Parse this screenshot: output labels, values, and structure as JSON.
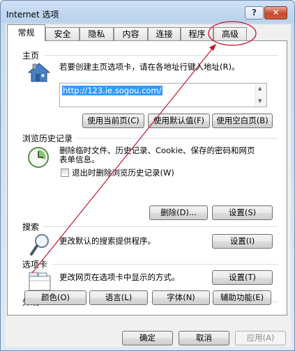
{
  "window": {
    "title": "Internet 选项",
    "help_label": "?",
    "close_label": "✕"
  },
  "tabs": [
    "常规",
    "安全",
    "隐私",
    "内容",
    "连接",
    "程序",
    "高级"
  ],
  "homepage": {
    "heading": "主页",
    "description": "若要创建主页选项卡，请在各地址行键入地址(R)。",
    "url": "http://123.ie.sogou.com/",
    "btn_current": "使用当前页(C)",
    "btn_default": "使用默认值(F)",
    "btn_blank": "使用空白页(B)"
  },
  "history": {
    "heading": "浏览历史记录",
    "description_line1": "删除临时文件、历史记录、Cookie、保存的密码和网页",
    "description_line2": "表单信息。",
    "checkbox_label": "退出时删除浏览历史记录(W)",
    "btn_delete": "删除(D)...",
    "btn_settings": "设置(S)"
  },
  "search": {
    "heading": "搜索",
    "description": "更改默认的搜索提供程序。",
    "btn_settings": "设置(I)"
  },
  "tabs_section": {
    "heading": "选项卡",
    "description": "更改网页在选项卡中显示的方式。",
    "btn_settings": "设置(T)"
  },
  "appearance": {
    "heading": "外观",
    "btn_colors": "颜色(O)",
    "btn_languages": "语言(L)",
    "btn_fonts": "字体(N)",
    "btn_accessibility": "辅助功能(E)"
  },
  "footer": {
    "ok": "确定",
    "cancel": "取消",
    "apply": "应用(A)"
  },
  "colors": {
    "annotation": "#c8102e",
    "title_bar": "#c7dbef",
    "selection": "#3399ff"
  }
}
